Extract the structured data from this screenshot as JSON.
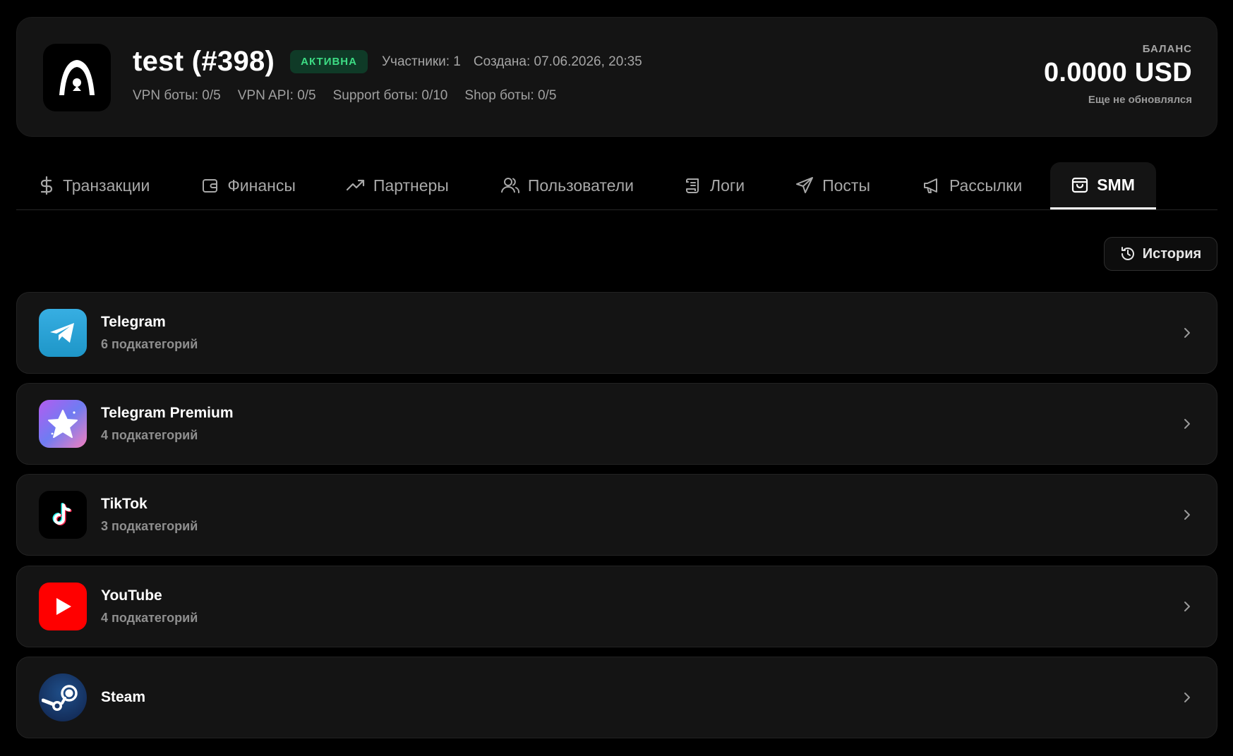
{
  "header": {
    "title": "test (#398)",
    "status_badge": "АКТИВНА",
    "members": "Участники: 1",
    "created": "Создана: 07.06.2026, 20:35",
    "limits": [
      "VPN боты: 0/5",
      "VPN API: 0/5",
      "Support боты: 0/10",
      "Shop боты: 0/5"
    ],
    "balance_label": "БАЛАНС",
    "balance_value": "0.0000 USD",
    "balance_note": "Еще не обновлялся"
  },
  "tabs": [
    {
      "label": "Транзакции",
      "icon": "dollar-icon"
    },
    {
      "label": "Финансы",
      "icon": "wallet-icon"
    },
    {
      "label": "Партнеры",
      "icon": "trend-up-icon"
    },
    {
      "label": "Пользователи",
      "icon": "users-icon"
    },
    {
      "label": "Логи",
      "icon": "scroll-icon"
    },
    {
      "label": "Посты",
      "icon": "send-icon"
    },
    {
      "label": "Рассылки",
      "icon": "megaphone-icon"
    },
    {
      "label": "SMM",
      "icon": "shopping-bag-icon",
      "active": true
    }
  ],
  "history_button": "История",
  "categories": [
    {
      "name": "Telegram",
      "subtitle": "6 подкатегорий",
      "icon": "telegram-icon"
    },
    {
      "name": "Telegram Premium",
      "subtitle": "4 подкатегорий",
      "icon": "telegram-premium-star-icon"
    },
    {
      "name": "TikTok",
      "subtitle": "3 подкатегорий",
      "icon": "tiktok-icon"
    },
    {
      "name": "YouTube",
      "subtitle": "4 подкатегорий",
      "icon": "youtube-icon"
    },
    {
      "name": "Steam",
      "subtitle": "",
      "icon": "steam-icon"
    }
  ],
  "colors": {
    "background": "#000000",
    "card": "#141414",
    "badge_bg": "#0f3a27",
    "badge_text": "#3ddc84",
    "telegram": "#2aa3e0",
    "youtube": "#ff0000"
  }
}
